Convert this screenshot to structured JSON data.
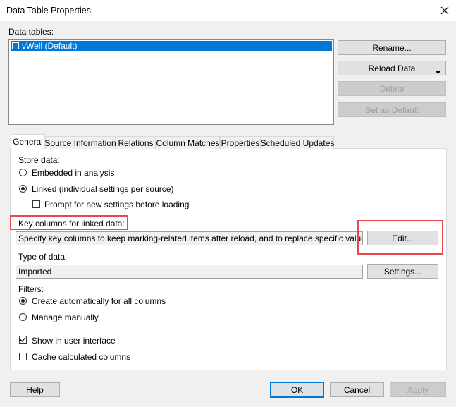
{
  "window": {
    "title": "Data Table Properties",
    "close_icon": "close-icon"
  },
  "data_tables": {
    "label": "Data tables:",
    "items": [
      {
        "label": "vWell (Default)",
        "selected": true
      }
    ]
  },
  "side_buttons": {
    "rename": "Rename...",
    "reload": "Reload Data",
    "delete": "Delete",
    "set_default": "Set as Default"
  },
  "tabs": [
    {
      "label": "General",
      "active": true
    },
    {
      "label": "Source Information",
      "active": false
    },
    {
      "label": "Relations",
      "active": false
    },
    {
      "label": "Column Matches",
      "active": false
    },
    {
      "label": "Properties",
      "active": false
    },
    {
      "label": "Scheduled Updates",
      "active": false
    }
  ],
  "general": {
    "store_data_label": "Store data:",
    "embedded_label": "Embedded in analysis",
    "linked_label": "Linked (individual settings per source)",
    "prompt_label": "Prompt for new settings before loading",
    "key_columns_label": "Key columns for linked data:",
    "key_columns_value": "Specify key columns to keep marking-related items after reload, and to replace specific values",
    "edit_button": "Edit...",
    "type_label": "Type of data:",
    "type_value": "Imported",
    "settings_button": "Settings...",
    "filters_label": "Filters:",
    "create_auto_label": "Create automatically for all columns",
    "manage_manually_label": "Manage manually",
    "show_ui_label": "Show in user interface",
    "cache_label": "Cache calculated columns",
    "store_mode": "linked",
    "filters_mode": "auto",
    "prompt_checked": false,
    "show_ui_checked": true,
    "cache_checked": false
  },
  "footer": {
    "help": "Help",
    "ok": "OK",
    "cancel": "Cancel",
    "apply": "Apply"
  },
  "colors": {
    "selection": "#0078d7",
    "highlight": "#e8484a",
    "dialog_bg": "#f0f0f0"
  }
}
